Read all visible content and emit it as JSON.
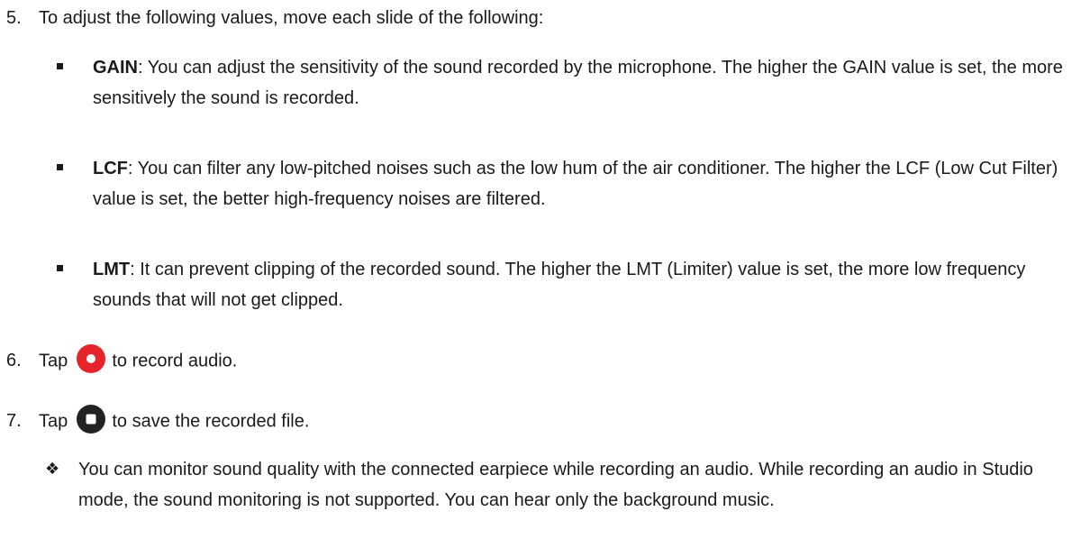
{
  "step5": {
    "number": "5.",
    "text": "To adjust the following values, move each slide of the following:"
  },
  "bullets": [
    {
      "term": "GAIN",
      "text": ": You can adjust the sensitivity of the sound recorded by the microphone. The higher the GAIN value is set, the more sensitively the sound is recorded."
    },
    {
      "term": "LCF",
      "text": ": You can filter any low-pitched noises such as the low hum of the air conditioner. The higher the LCF (Low Cut Filter) value is set, the better high-frequency noises are filtered."
    },
    {
      "term": "LMT",
      "text": ": It can prevent clipping of the recorded sound. The higher the LMT (Limiter) value is set, the more low frequency sounds that will not get clipped."
    }
  ],
  "step6": {
    "number": "6.",
    "before": "Tap",
    "after": "to record audio.",
    "icon": "record-icon",
    "icon_color": "#e8242b"
  },
  "step7": {
    "number": "7.",
    "before": "Tap",
    "after": "to save the recorded file.",
    "icon": "stop-icon",
    "icon_color": "#222222"
  },
  "note": {
    "symbol": "❖",
    "text": "You can monitor sound quality with the connected earpiece while recording an audio. While recording an audio in Studio mode, the sound monitoring is not supported. You can hear only the background music."
  }
}
